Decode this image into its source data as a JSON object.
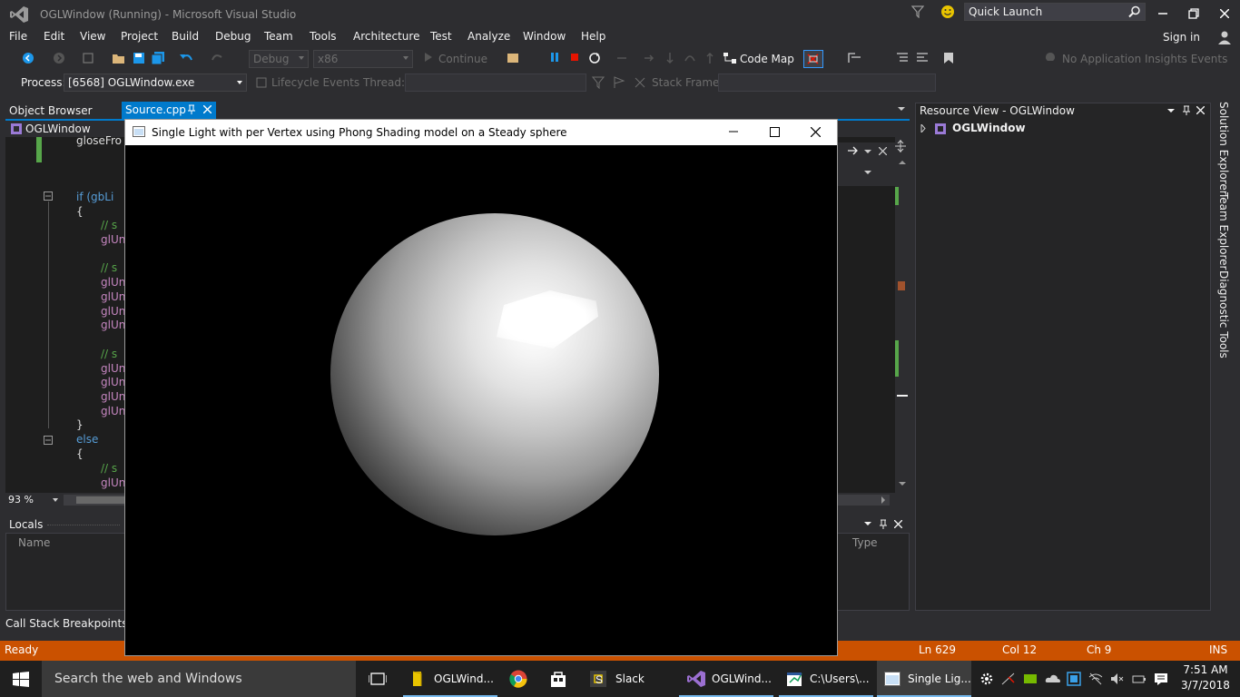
{
  "window": {
    "title": "OGLWindow (Running) - Microsoft Visual Studio",
    "quick_launch_placeholder": "Quick Launch",
    "sign_in": "Sign in"
  },
  "menu": [
    "File",
    "Edit",
    "View",
    "Project",
    "Build",
    "Debug",
    "Team",
    "Tools",
    "Architecture",
    "Test",
    "Analyze",
    "Window",
    "Help"
  ],
  "toolbar": {
    "config": "Debug",
    "platform": "x86",
    "continue": "Continue",
    "code_map": "Code Map",
    "app_insights": "No Application Insights Events"
  },
  "debug_location": {
    "process_label": "Process:",
    "process_value": "[6568] OGLWindow.exe",
    "lifecycle": "Lifecycle Events",
    "thread_label": "Thread:",
    "stack_frame_label": "Stack Frame:"
  },
  "editor": {
    "tab_object_browser": "Object Browser",
    "tab_source": "Source.cpp",
    "nav_project": "OGLWindow",
    "zoom": "93 %",
    "code": [
      {
        "text": "gloseFro",
        "kind": "plain"
      },
      {
        "text": "if (gbLi",
        "kind": "kw"
      },
      {
        "text": "{",
        "kind": "plain"
      },
      {
        "text": "// s",
        "kind": "cm"
      },
      {
        "text": "glUn",
        "kind": "fn"
      },
      {
        "text": "// s",
        "kind": "cm"
      },
      {
        "text": "glUn",
        "kind": "fn"
      },
      {
        "text": "glUn",
        "kind": "fn"
      },
      {
        "text": "glUn",
        "kind": "fn"
      },
      {
        "text": "glUn",
        "kind": "fn"
      },
      {
        "text": "// s",
        "kind": "cm"
      },
      {
        "text": "glUn",
        "kind": "fn"
      },
      {
        "text": "glUn",
        "kind": "fn"
      },
      {
        "text": "glUn",
        "kind": "fn"
      },
      {
        "text": "glUn",
        "kind": "fn"
      },
      {
        "text": "}",
        "kind": "plain"
      },
      {
        "text": "else",
        "kind": "kw"
      },
      {
        "text": "{",
        "kind": "plain"
      },
      {
        "text": "// s",
        "kind": "cm"
      },
      {
        "text": "glUn",
        "kind": "fn"
      }
    ]
  },
  "locals": {
    "title": "Locals",
    "col_name": "Name",
    "col_type": "Type",
    "tab_callstack": "Call Stack",
    "tab_breakpoints": "Breakpoints"
  },
  "resource_view": {
    "title": "Resource View - OGLWindow",
    "item": "OGLWindow",
    "side_tabs": [
      "Solution Explorer",
      "Team Explorer",
      "Diagnostic Tools"
    ]
  },
  "statusbar": {
    "state": "Ready",
    "line": "Ln 629",
    "col": "Col 12",
    "ch": "Ch 9",
    "mode": "INS"
  },
  "gl_window": {
    "title": "Single Light with per Vertex using Phong Shading model on a Steady sphere"
  },
  "taskbar": {
    "search": "Search the web and Windows",
    "apps": [
      "OGLWind...",
      "Slack",
      "OGLWind...",
      "C:\\Users\\...",
      "Single Lig..."
    ],
    "time": "7:51 AM",
    "date": "3/7/2018"
  },
  "colors": {
    "accent": "#007acc",
    "statusbar": "#ca5100",
    "background": "#2d2d30"
  }
}
